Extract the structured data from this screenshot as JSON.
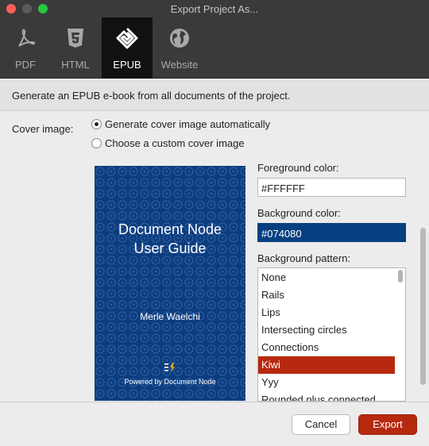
{
  "window": {
    "title": "Export Project As..."
  },
  "tabs": [
    {
      "label": "PDF",
      "icon": "pdf-icon"
    },
    {
      "label": "HTML",
      "icon": "html5-icon"
    },
    {
      "label": "EPUB",
      "icon": "epub-icon",
      "active": true
    },
    {
      "label": "Website",
      "icon": "globe-icon"
    }
  ],
  "description": "Generate an EPUB e-book from all documents of the project.",
  "cover": {
    "label": "Cover image:",
    "options": [
      "Generate cover image automatically",
      "Choose a custom cover image"
    ],
    "selected": 0,
    "preview": {
      "title_line1": "Document Node",
      "title_line2": "User Guide",
      "author": "Merle Waelchi",
      "powered_by": "Powered by Document Node"
    }
  },
  "foreground": {
    "label": "Foreground color:",
    "value": "#FFFFFF"
  },
  "background": {
    "label": "Background color:",
    "value": "#074080"
  },
  "pattern": {
    "label": "Background pattern:",
    "items": [
      "None",
      "Rails",
      "Lips",
      "Intersecting circles",
      "Connections",
      "Kiwi",
      "Yyy",
      "Rounded plus connected"
    ],
    "selected": "Kiwi"
  },
  "buttons": {
    "cancel": "Cancel",
    "export": "Export"
  },
  "colors": {
    "accent": "#b7290f",
    "toolbar": "#3a3a3a",
    "cover_bg": "#0c3d80"
  }
}
